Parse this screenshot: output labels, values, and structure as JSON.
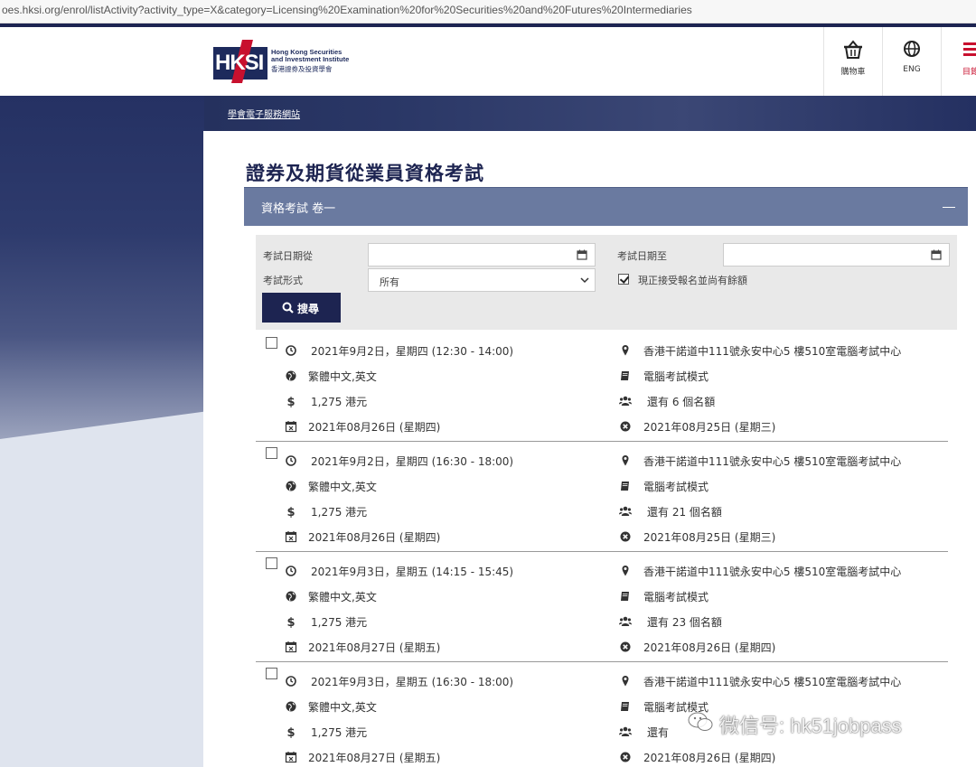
{
  "browser": {
    "url": "oes.hksi.org/enrol/listActivity?activity_type=X&category=Licensing%20Examination%20for%20Securities%20and%20Futures%20Intermediaries"
  },
  "header": {
    "logo": {
      "mark": "HKSI",
      "en_line1": "Hong Kong Securities",
      "en_line2": "and Investment Institute",
      "zh": "香港證券及投資學會"
    },
    "cart_label": "購物車",
    "lang_label": "ENG",
    "menu_label": "目錄"
  },
  "breadcrumb": "學會電子服務網站",
  "page_title": "證券及期貨從業員資格考試",
  "accordion": {
    "title": "資格考試 卷一",
    "collapse_symbol": "—"
  },
  "filter": {
    "date_from_label": "考試日期從",
    "date_from_value": "",
    "date_to_label": "考試日期至",
    "date_to_value": "",
    "mode_label": "考試形式",
    "mode_value": "所有",
    "available_only_label": "現正接受報名並尚有餘額",
    "available_only_checked": true,
    "search_label": "搜尋"
  },
  "sessions": [
    {
      "datetime": "2021年9月2日，星期四 (12:30 - 14:00)",
      "venue": "香港干諾道中111號永安中心5 樓510室電腦考試中心",
      "language": "繁體中文,英文",
      "mode": "電腦考試模式",
      "fee": "1,275 港元",
      "seats": "還有 6 個名額",
      "result_date": "2021年08月26日 (星期四)",
      "deadline": "2021年08月25日 (星期三)"
    },
    {
      "datetime": "2021年9月2日，星期四 (16:30 - 18:00)",
      "venue": "香港干諾道中111號永安中心5 樓510室電腦考試中心",
      "language": "繁體中文,英文",
      "mode": "電腦考試模式",
      "fee": "1,275 港元",
      "seats": "還有 21 個名額",
      "result_date": "2021年08月26日 (星期四)",
      "deadline": "2021年08月25日 (星期三)"
    },
    {
      "datetime": "2021年9月3日，星期五 (14:15 - 15:45)",
      "venue": "香港干諾道中111號永安中心5 樓510室電腦考試中心",
      "language": "繁體中文,英文",
      "mode": "電腦考試模式",
      "fee": "1,275 港元",
      "seats": "還有 23 個名額",
      "result_date": "2021年08月27日 (星期五)",
      "deadline": "2021年08月26日 (星期四)"
    },
    {
      "datetime": "2021年9月3日，星期五 (16:30 - 18:00)",
      "venue": "香港干諾道中111號永安中心5 樓510室電腦考試中心",
      "language": "繁體中文,英文",
      "mode": "電腦考試模式",
      "fee": "1,275 港元",
      "seats": "還有",
      "result_date": "2021年08月27日 (星期五)",
      "deadline": "2021年08月26日 (星期四)"
    }
  ],
  "watermark": "微信号: hk51jobpass",
  "colors": {
    "navy": "#1d2451",
    "accordion": "#6a7aa0",
    "brand_red": "#c8102e"
  }
}
